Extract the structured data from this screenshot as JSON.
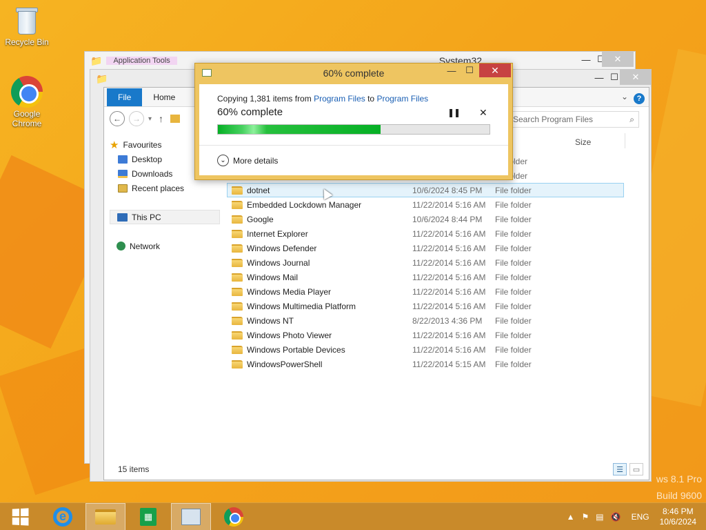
{
  "desktop": {
    "icons": [
      {
        "label": "Recycle Bin",
        "icon": "recycle-bin-icon"
      },
      {
        "label": "Google Chrome",
        "icon": "chrome-icon"
      }
    ],
    "watermark_line1": "ws 8.1 Pro",
    "watermark_line2": "Build 9600"
  },
  "back_window": {
    "title": "System32",
    "partial_tab": "Application Tools"
  },
  "explorer": {
    "tabs": {
      "file": "File",
      "home": "Home"
    },
    "search_placeholder": "Search Program Files",
    "column_size": "Size",
    "nav": {
      "favourites": "Favourites",
      "desktop": "Desktop",
      "downloads": "Downloads",
      "recent": "Recent places",
      "this_pc": "This PC",
      "network": "Network"
    },
    "partial_types": [
      "folder",
      "folder"
    ],
    "files": [
      {
        "name": "dotnet",
        "date": "10/6/2024 8:45 PM",
        "type": "File folder",
        "selected": true
      },
      {
        "name": "Embedded Lockdown Manager",
        "date": "11/22/2014 5:16 AM",
        "type": "File folder"
      },
      {
        "name": "Google",
        "date": "10/6/2024 8:44 PM",
        "type": "File folder"
      },
      {
        "name": "Internet Explorer",
        "date": "11/22/2014 5:16 AM",
        "type": "File folder"
      },
      {
        "name": "Windows Defender",
        "date": "11/22/2014 5:16 AM",
        "type": "File folder"
      },
      {
        "name": "Windows Journal",
        "date": "11/22/2014 5:16 AM",
        "type": "File folder"
      },
      {
        "name": "Windows Mail",
        "date": "11/22/2014 5:16 AM",
        "type": "File folder"
      },
      {
        "name": "Windows Media Player",
        "date": "11/22/2014 5:16 AM",
        "type": "File folder"
      },
      {
        "name": "Windows Multimedia Platform",
        "date": "11/22/2014 5:16 AM",
        "type": "File folder"
      },
      {
        "name": "Windows NT",
        "date": "8/22/2013 4:36 PM",
        "type": "File folder"
      },
      {
        "name": "Windows Photo Viewer",
        "date": "11/22/2014 5:16 AM",
        "type": "File folder"
      },
      {
        "name": "Windows Portable Devices",
        "date": "11/22/2014 5:16 AM",
        "type": "File folder"
      },
      {
        "name": "WindowsPowerShell",
        "date": "11/22/2014 5:15 AM",
        "type": "File folder"
      }
    ],
    "status": "15 items"
  },
  "copy_dialog": {
    "title": "60% complete",
    "copy_prefix": "Copying 1,381 items from ",
    "source": "Program Files",
    "to_word": " to ",
    "destination": "Program Files",
    "percent_label": "60% complete",
    "progress_fraction": 0.6,
    "more_details": "More details"
  },
  "taskbar": {
    "language": "ENG",
    "time": "8:46 PM",
    "date": "10/6/2024"
  }
}
